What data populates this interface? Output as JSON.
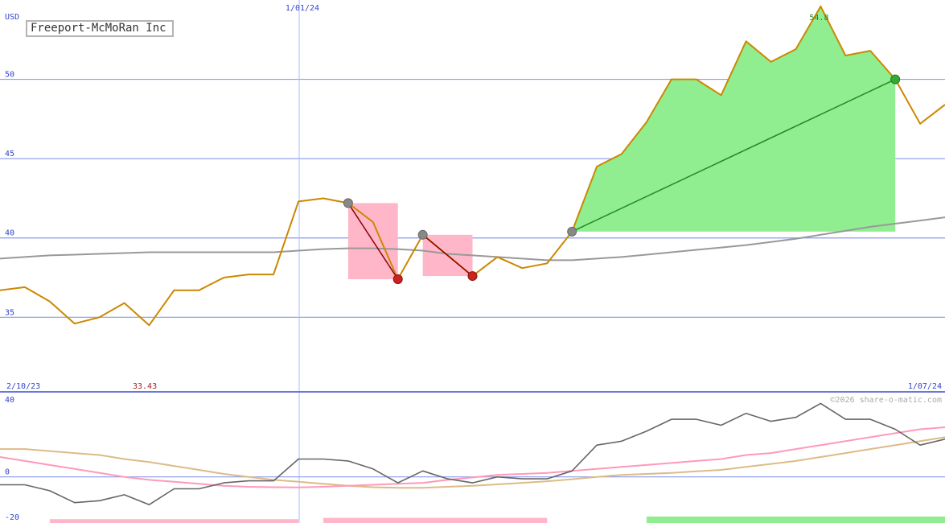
{
  "ticker_name": "Freeport-McMoRan Inc",
  "currency_label": "USD",
  "copyright": "©2026 share-o-matic.com",
  "colors": {
    "price": "#cc8800",
    "ma_long": "#999999",
    "grid": "#8899ee",
    "gain_fill": "#90ee90",
    "gain_line": "#228b22",
    "loss_fill": "#ffb6c8",
    "loss_line": "#8b0000",
    "osc": "#666666",
    "osc_fast": "#ff99bb",
    "osc_slow": "#ddbb88",
    "axis_text": "#3344cc",
    "low_text": "#aa2222",
    "high_text": "#228b22"
  },
  "chart_data": [
    {
      "type": "line",
      "title": "",
      "currency": "USD",
      "x_start_label": "2/10/23",
      "x_mid_label": "1/01/24",
      "x_end_label": "1/07/24",
      "ylim": [
        30.3,
        55
      ],
      "yticks": [
        35,
        40,
        45,
        50
      ],
      "series": [
        {
          "values": [
            36.7,
            36.9,
            36.0,
            34.6,
            35.0,
            35.9,
            34.5,
            36.7,
            36.7,
            37.5,
            37.7,
            37.7,
            42.3,
            42.5,
            42.2,
            41.0,
            37.4,
            40.2,
            38.9,
            37.6,
            38.8,
            38.1,
            38.4,
            40.4,
            44.5,
            45.3,
            47.3,
            50.0,
            50.0,
            49.0,
            52.4,
            51.1,
            51.9,
            54.6,
            51.5,
            51.8,
            50.0,
            47.2,
            48.4
          ]
        },
        {
          "values": [
            38.7,
            38.8,
            38.9,
            38.95,
            39.0,
            39.05,
            39.1,
            39.1,
            39.1,
            39.1,
            39.1,
            39.1,
            39.2,
            39.3,
            39.35,
            39.35,
            39.3,
            39.2,
            39.0,
            38.9,
            38.8,
            38.7,
            38.6,
            38.6,
            38.7,
            38.8,
            38.95,
            39.1,
            39.25,
            39.4,
            39.55,
            39.75,
            39.95,
            40.2,
            40.45,
            40.7,
            40.9,
            41.1,
            41.3
          ]
        }
      ],
      "trades": [
        {
          "type": "loss",
          "entry_index": 14,
          "entry_price": 42.2,
          "exit_index": 16,
          "exit_price": 37.4
        },
        {
          "type": "loss",
          "entry_index": 17,
          "entry_price": 40.2,
          "exit_index": 19,
          "exit_price": 37.6
        },
        {
          "type": "gain",
          "entry_index": 23,
          "entry_price": 40.4,
          "exit_index": 36,
          "exit_price": 50.0
        }
      ],
      "low": {
        "index": 5,
        "label": "33.43"
      },
      "high": {
        "index": 33,
        "label": "54.8"
      }
    },
    {
      "type": "line",
      "title": "",
      "ylim": [
        -20,
        40
      ],
      "yticks": [
        40,
        0,
        -20
      ],
      "series": [
        {
          "values": [
            -4,
            -4,
            -7,
            -13,
            -12,
            -9,
            -14,
            -6,
            -6,
            -3,
            -2,
            -2,
            9,
            9,
            8,
            4,
            -3,
            3,
            -1,
            -3,
            0,
            -1,
            -1,
            3,
            16,
            18,
            23,
            29,
            29,
            26,
            32,
            28,
            30,
            37,
            29,
            29,
            24,
            16,
            19
          ]
        },
        {
          "values": [
            10,
            8,
            6,
            4,
            2,
            0,
            -1.5,
            -2.5,
            -3.5,
            -4.5,
            -5,
            -5.2,
            -5.3,
            -5,
            -4.5,
            -4,
            -3.5,
            -3,
            -1.5,
            -0.3,
            1,
            1.5,
            2,
            3,
            4,
            5,
            6,
            7,
            8,
            9,
            11,
            12,
            14,
            16,
            18,
            20,
            22,
            24,
            25
          ]
        },
        {
          "values": [
            14,
            14,
            13,
            12,
            11,
            9,
            7.5,
            5.5,
            3.5,
            1.5,
            0,
            -1.5,
            -2.5,
            -3.5,
            -4.5,
            -5.2,
            -5.5,
            -5.5,
            -5,
            -4.5,
            -3.8,
            -3,
            -2.2,
            -1.2,
            0,
            1,
            1.5,
            2,
            2.8,
            3.5,
            5,
            6.5,
            8,
            10,
            12,
            14,
            16,
            18,
            20
          ]
        }
      ],
      "volume_bars": [
        {
          "type": "loss",
          "x0": 2,
          "x1": 12,
          "h": 0.6
        },
        {
          "type": "loss",
          "x0": 13,
          "x1": 22,
          "h": 0.8
        },
        {
          "type": "gain",
          "x0": 26,
          "x1": 39,
          "h": 1.0
        }
      ]
    }
  ]
}
